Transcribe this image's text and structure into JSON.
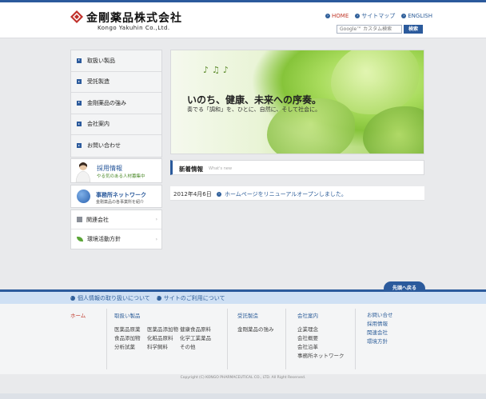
{
  "header": {
    "company_jp": "金剛薬品株式会社",
    "company_en": "Kongo Yakuhin Co.,Ltd.",
    "links": [
      {
        "label": "HOME",
        "active": true
      },
      {
        "label": "サイトマップ",
        "active": false
      },
      {
        "label": "ENGLISH",
        "active": false
      }
    ],
    "search_placeholder": "Google™ カスタム検索",
    "search_button": "検索"
  },
  "sidebar": {
    "items": [
      {
        "label": "取扱い製品"
      },
      {
        "label": "受託製造"
      },
      {
        "label": "金剛薬品の強み"
      },
      {
        "label": "会社案内"
      },
      {
        "label": "お問い合わせ"
      }
    ],
    "recruit": {
      "title": "採用情報",
      "subtitle": "やる気のある人材募集中"
    },
    "network": {
      "title": "事務所ネットワーク",
      "subtitle": "金剛薬品の各事業所を紹介"
    },
    "sublinks": [
      {
        "label": "関連会社",
        "icon": "building-icon"
      },
      {
        "label": "環境活動方針",
        "icon": "leaf-icon"
      }
    ]
  },
  "hero": {
    "title": "いのち、健康、未来への序奏。",
    "subtitle": "奏でる「調和」を、ひとに、自然に、そして社会に。"
  },
  "news": {
    "title": "新着情報",
    "title_en": "What's new",
    "items": [
      {
        "date": "2012年4月6日",
        "text": "ホームページをリニューアルオープンしました。"
      }
    ]
  },
  "footer": {
    "pagetop": "先頭へ戻る",
    "policy_links": [
      "個人情報の取り扱いについて",
      "サイトのご利用について"
    ],
    "home": "ホーム",
    "products": {
      "head": "取扱い製品",
      "items": [
        "医薬品原薬",
        "医薬品添加物",
        "健康食品原料",
        "食品添加物",
        "化粧品原料",
        "化学工業薬品",
        "分析試薬",
        "科学飼料",
        "その他"
      ]
    },
    "contract": {
      "head": "受託製造",
      "items": [
        "金剛薬品の強み"
      ]
    },
    "company": {
      "head": "会社案内",
      "items": [
        "企業理念",
        "会社概要",
        "会社沿革",
        "事務所ネットワーク"
      ]
    },
    "others": [
      "お問い合せ",
      "採用情報",
      "関連会社",
      "環境方針"
    ],
    "copyright": "Copyright (C) KONGO PHARMACEUTICAL CO., LTD. All Right Reserved."
  },
  "colors": {
    "accent": "#2b5a9c",
    "home_red": "#c0392b",
    "leaf_green": "#86c43a"
  }
}
